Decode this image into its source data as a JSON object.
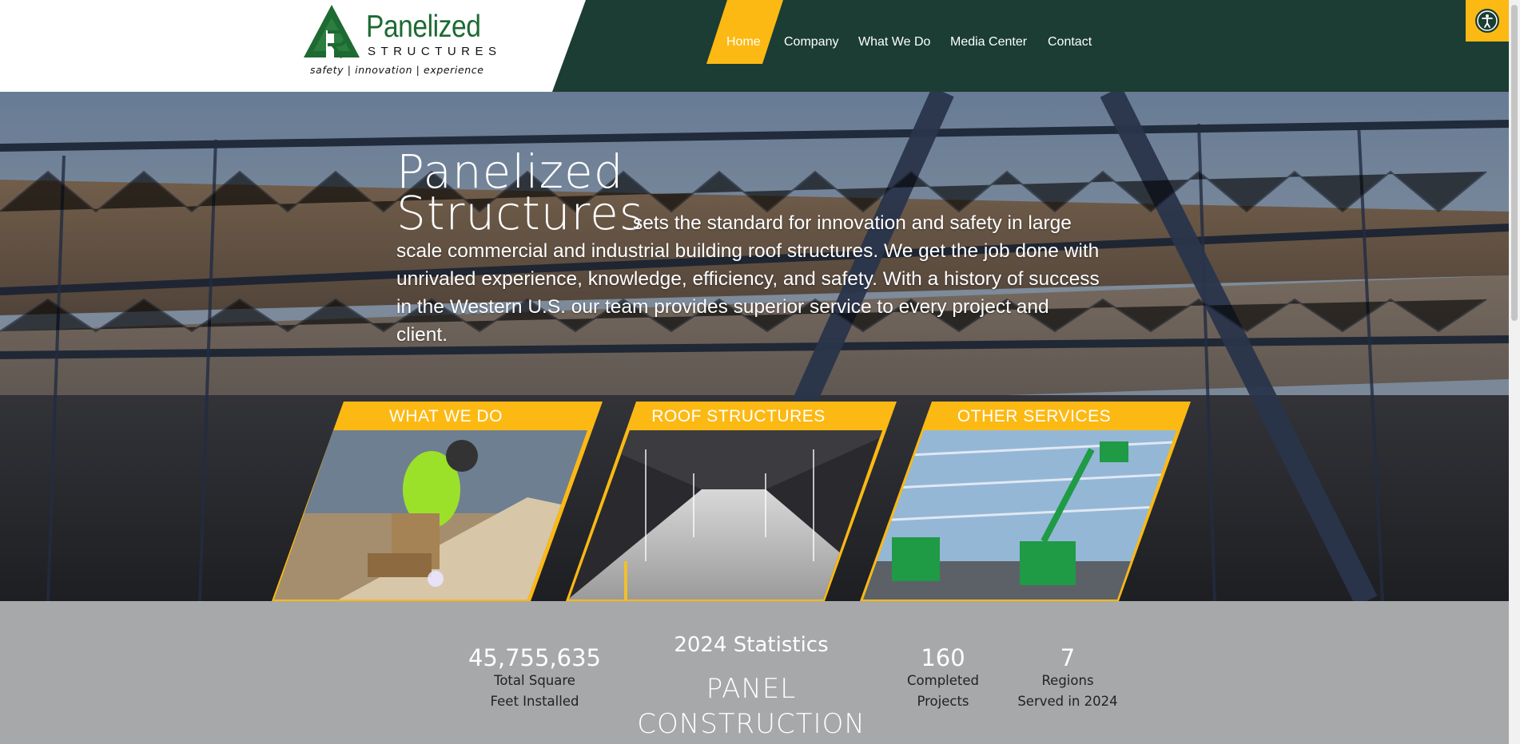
{
  "colors": {
    "brand_green": "#1b3d33",
    "accent_yellow": "#fdb913",
    "stats_gray": "#a7a8aa"
  },
  "logo": {
    "word": "Panelized",
    "sub": "STRUCTURES",
    "tagline": "safety | innovation | experience"
  },
  "nav": {
    "items": [
      {
        "label": "Home",
        "active": true
      },
      {
        "label": "Company"
      },
      {
        "label": "What We Do"
      },
      {
        "label": "Media Center"
      },
      {
        "label": "Contact"
      }
    ]
  },
  "accessibility": {
    "icon": "accessibility-icon"
  },
  "hero": {
    "title_line1": "Panelized",
    "title_line2": "Structures",
    "text": "sets the standard for innovation and safety in large scale commercial and industrial building roof structures. We get the job done with unrivaled experience, knowledge, efficiency, and safety. With a history of success in the Western U.S. our team provides superior service to every project and client."
  },
  "cards": [
    {
      "label": "WHAT WE DO"
    },
    {
      "label": "ROOF STRUCTURES"
    },
    {
      "label": "OTHER SERVICES"
    }
  ],
  "stats": {
    "heading": "2024 Statistics",
    "subheading_line1": "PANEL",
    "subheading_line2": "CONSTRUCTION",
    "items": [
      {
        "number": "45,755,635",
        "label_line1": "Total Square",
        "label_line2": "Feet Installed"
      },
      {
        "number": "160",
        "label_line1": "Completed",
        "label_line2": "Projects"
      },
      {
        "number": "7",
        "label_line1": "Regions",
        "label_line2": "Served in 2024"
      }
    ]
  }
}
